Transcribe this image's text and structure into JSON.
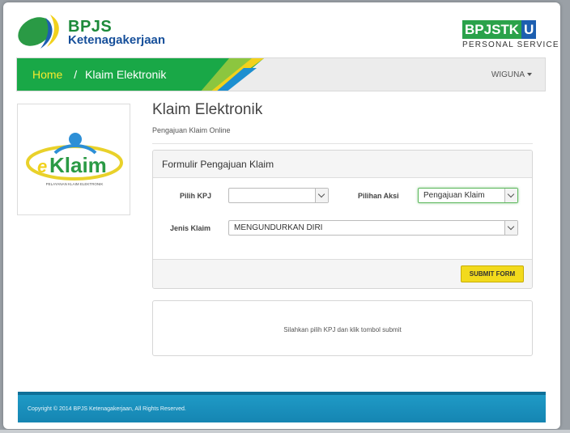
{
  "header": {
    "logo_name": "BPJS",
    "logo_sub": "Ketenagakerjaan",
    "brand_main": "BPJSTK",
    "brand_ku": "U",
    "brand_tagline": "PERSONAL SERVICE"
  },
  "nav": {
    "home_label": "Home",
    "separator": "/",
    "current_label": "Klaim Elektronik",
    "user_label": "WIGUNA"
  },
  "side": {
    "eklaim_e": "e",
    "eklaim_word": "Klaim",
    "eklaim_tagline": "PELAYANAN KLAIM ELEKTRONIK"
  },
  "main": {
    "title": "Klaim Elektronik",
    "subtitle": "Pengajuan Klaim Online"
  },
  "form": {
    "panel_title": "Formulir Pengajuan Klaim",
    "pilih_kpj_label": "Pilih KPJ",
    "pilih_kpj_value": "",
    "pilihan_aksi_label": "Pilihan Aksi",
    "pilihan_aksi_value": "Pengajuan Klaim",
    "jenis_klaim_label": "Jenis Klaim",
    "jenis_klaim_value": "MENGUNDURKAN DIRI",
    "submit_label": "SUBMIT FORM"
  },
  "message": {
    "text": "Silahkan pilih KPJ dan klik tombol submit"
  },
  "footer": {
    "copyright": "Copyright © 2014 BPJS Ketenagakerjaan, All Rights Reserved."
  },
  "colors": {
    "brand_green": "#1c8a3a",
    "brand_blue": "#164f9a",
    "nav_green": "#19a847",
    "home_yellow": "#f7ea2e",
    "submit_yellow": "#f2da1c",
    "footer_blue": "#1f9ac6"
  }
}
